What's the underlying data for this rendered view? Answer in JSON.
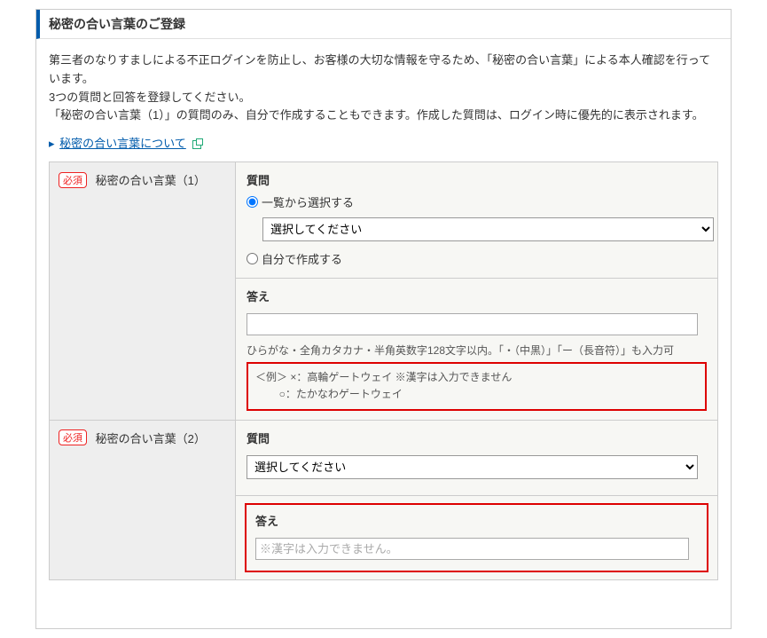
{
  "header": {
    "title": "秘密の合い言葉のご登録"
  },
  "intro": {
    "p1": "第三者のなりすましによる不正ログインを防止し、お客様の大切な情報を守るため、「秘密の合い言葉」による本人確認を行っています。",
    "p2": "3つの質問と回答を登録してください。",
    "p3": "「秘密の合い言葉（1）」の質問のみ、自分で作成することもできます。作成した質問は、ログイン時に優先的に表示されます。"
  },
  "link": {
    "label": "秘密の合い言葉について"
  },
  "badge": {
    "required": "必須"
  },
  "row1": {
    "label": "秘密の合い言葉（1）",
    "question_label": "質問",
    "radio_select": "一覧から選択する",
    "radio_custom": "自分で作成する",
    "select_placeholder": "選択してください",
    "answer_label": "答え",
    "note": "ひらがな・全角カタカナ・半角英数字128文字以内。「・（中黒）」「ー（長音符）」も入力可",
    "example_l1": "＜例＞ ×：高輪ゲートウェイ  ※漢字は入力できません",
    "example_l2": "        ○：たかなわゲートウェイ"
  },
  "row2": {
    "label": "秘密の合い言葉（2）",
    "question_label": "質問",
    "select_placeholder": "選択してください",
    "answer_label": "答え",
    "answer_placeholder": "※漢字は入力できません。"
  }
}
